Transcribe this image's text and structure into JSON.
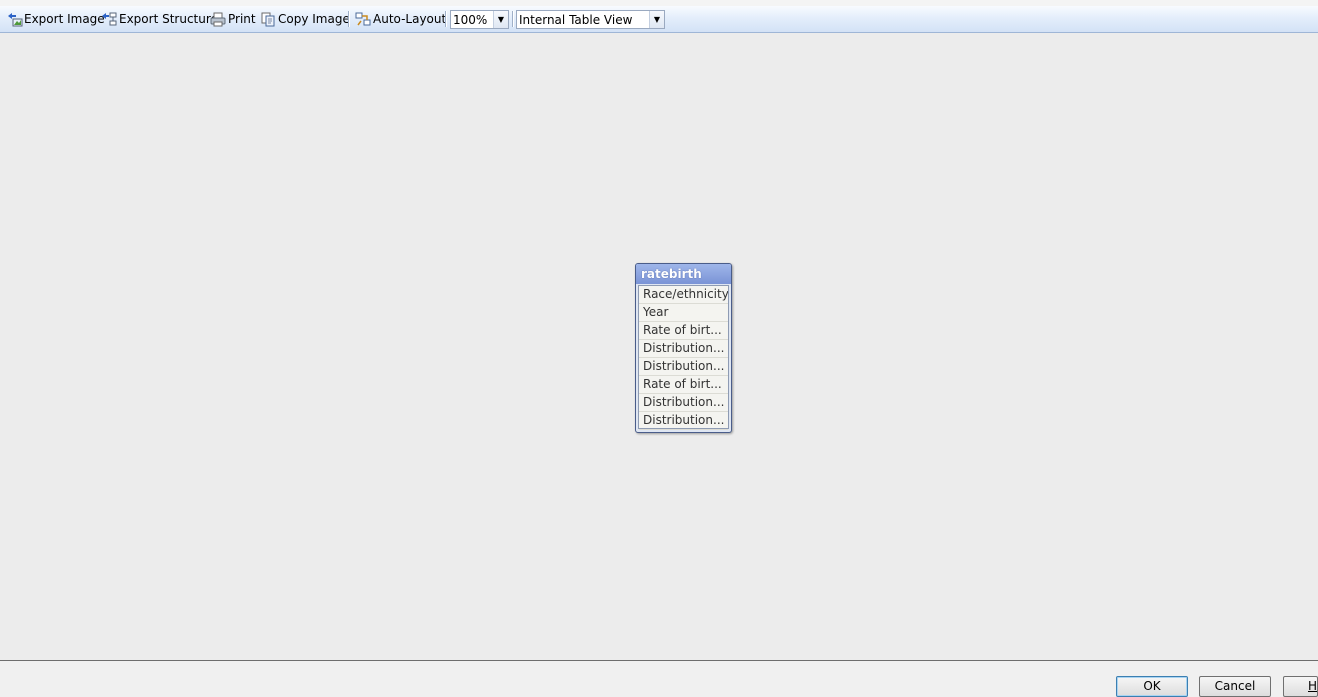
{
  "toolbar": {
    "export_image": "Export Image",
    "export_structure": "Export Structure",
    "print": "Print",
    "copy_image": "Copy Image",
    "auto_layout": "Auto-Layout",
    "zoom_value": "100%",
    "view_value": "Internal Table View"
  },
  "table": {
    "name": "ratebirth",
    "fields": [
      "Race/ethnicity",
      "Year",
      "Rate of birt...",
      "Distribution...",
      "Distribution...",
      "Rate of birt...",
      "Distribution...",
      "Distribution..."
    ]
  },
  "dialog": {
    "ok": "OK",
    "cancel": "Cancel",
    "help": "H"
  }
}
